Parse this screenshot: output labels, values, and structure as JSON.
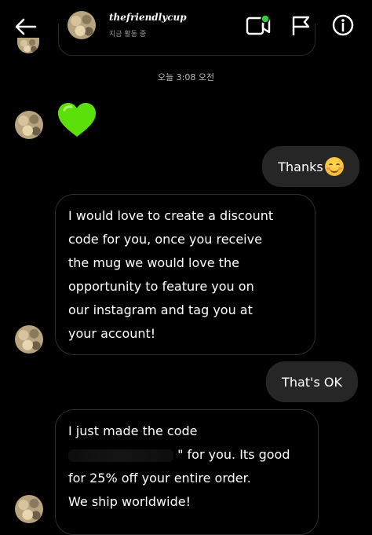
{
  "header": {
    "username": "thefriendlycup",
    "status": "지금 활동 중"
  },
  "timestamp": "오늘 3:08 오전",
  "messages": {
    "heart_emoji": "green-heart",
    "thanks": "Thanks",
    "thanks_emoji": "smiling-face-with-smiling-eyes",
    "discount_lines": [
      "I would love to create a discount",
      "code for you, once you receive",
      "the mug we would love the",
      "opportunity to feature you on",
      "our instagram and tag you at",
      "your account!"
    ],
    "thats_ok": "That's OK",
    "code_lines": [
      "I just made the code",
      "\" for you. Its good",
      "for 25% off your entire order.",
      "We ship worldwide!"
    ]
  },
  "colors": {
    "background": "#000000",
    "outgoing_bubble": "#262626",
    "online_dot": "#2ecc40",
    "heart": "#5ce00a"
  }
}
